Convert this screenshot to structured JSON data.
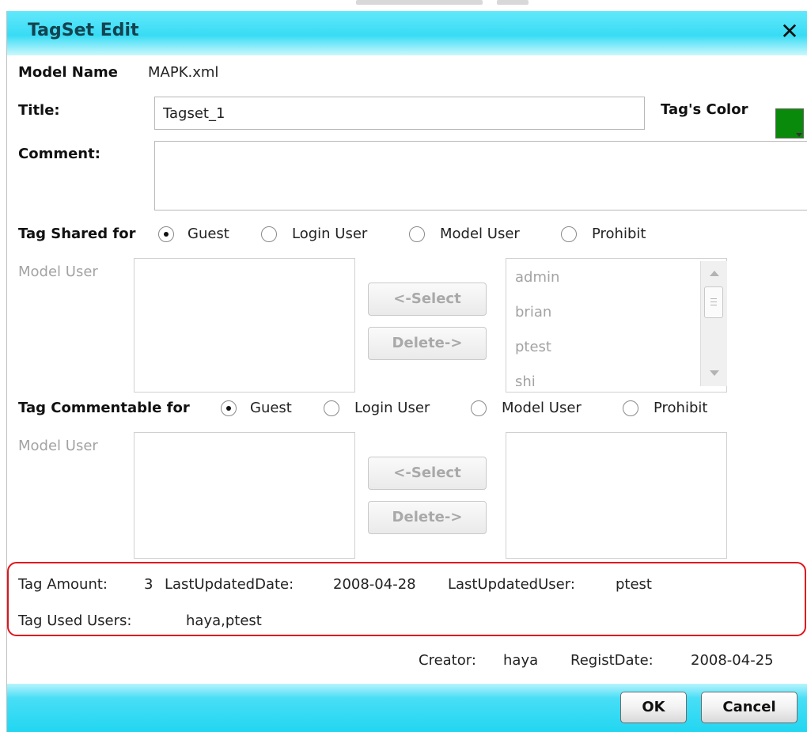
{
  "dialog": {
    "title": "TagSet Edit",
    "close_glyph": "✕"
  },
  "model": {
    "label": "Model Name",
    "value": "MAPK.xml"
  },
  "title_field": {
    "label": "Title:",
    "value": "Tagset_1"
  },
  "tag_color": {
    "label": "Tag's Color",
    "color": "#0a8a0a"
  },
  "comment": {
    "label": "Comment:",
    "value": ""
  },
  "shared": {
    "label": "Tag Shared for",
    "options": [
      {
        "label": "Guest",
        "checked": true
      },
      {
        "label": "Login User",
        "checked": false
      },
      {
        "label": "Model User",
        "checked": false
      },
      {
        "label": "Prohibit",
        "checked": false
      }
    ],
    "model_user_label": "Model User",
    "select_button": "<-Select",
    "delete_button": "Delete->",
    "users": [
      "admin",
      "brian",
      "ptest",
      "shi"
    ]
  },
  "commentable": {
    "label": "Tag Commentable for",
    "options": [
      {
        "label": "Guest",
        "checked": true
      },
      {
        "label": "Login User",
        "checked": false
      },
      {
        "label": "Model User",
        "checked": false
      },
      {
        "label": "Prohibit",
        "checked": false
      }
    ],
    "model_user_label": "Model User",
    "select_button": "<-Select",
    "delete_button": "Delete->"
  },
  "info": {
    "amount_label": "Tag Amount:",
    "amount_value": "3",
    "updated_date_label": "LastUpdatedDate:",
    "updated_date_value": "2008-04-28",
    "updated_user_label": "LastUpdatedUser:",
    "updated_user_value": "ptest",
    "used_users_label": "Tag Used Users:",
    "used_users_value": "haya,ptest"
  },
  "creator": {
    "creator_label": "Creator:",
    "creator_value": "haya",
    "regist_label": "RegistDate:",
    "regist_value": "2008-04-25"
  },
  "footer": {
    "ok": "OK",
    "cancel": "Cancel"
  },
  "colors": {
    "header_cyan": "#38dcf5",
    "highlight_red": "#e0141c",
    "tag_green": "#0a8a0a"
  }
}
